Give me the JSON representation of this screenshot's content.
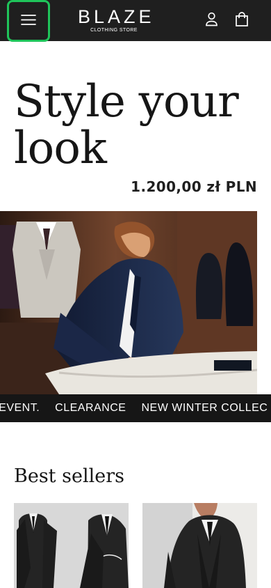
{
  "header": {
    "menu_icon": "hamburger-menu-icon",
    "logo": {
      "word": "BLAZE",
      "tagline": "CLOTHING STORE"
    },
    "account_icon": "user-icon",
    "bag_icon": "shopping-bag-icon",
    "colors": {
      "background": "#1f1f1f",
      "focus_outline": "#1fc45a"
    }
  },
  "hero": {
    "title": "Style your look",
    "price": "1.200,00 zł PLN",
    "image_description": "tailor-workshop-photo"
  },
  "marquee": {
    "items": [
      "ANT EVENT.",
      "CLEARANCE",
      "NEW WINTER COLLEC"
    ]
  },
  "best_sellers": {
    "title": "Best sellers",
    "products": [
      {
        "image": "two-black-suits-product-image"
      },
      {
        "image": "black-three-piece-suit-product-image"
      }
    ]
  }
}
